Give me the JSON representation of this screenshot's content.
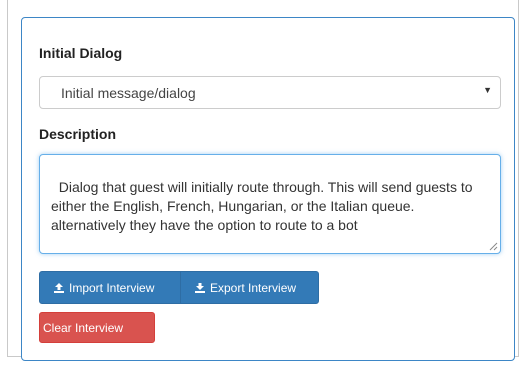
{
  "form": {
    "initial_dialog_label": "Initial Dialog",
    "initial_dialog_value": "Initial message/dialog",
    "description_label": "Description",
    "description_value": "Dialog that guest will initially route through. This will send guests to either the English, French, Hungarian, or the Italian queue. alternatively they have the option to route to a bot"
  },
  "buttons": {
    "import_label": "Import Interview",
    "export_label": "Export Interview",
    "clear_label": "Clear Interview"
  },
  "icons": {
    "select_caret": "caret-down-icon",
    "import": "upload-icon",
    "export": "download-icon",
    "resize": "resize-handle-icon"
  },
  "colors": {
    "primary": "#337ab7",
    "danger": "#d9534f",
    "focus_border": "#66afe9",
    "panel_border": "#3d86c6"
  }
}
